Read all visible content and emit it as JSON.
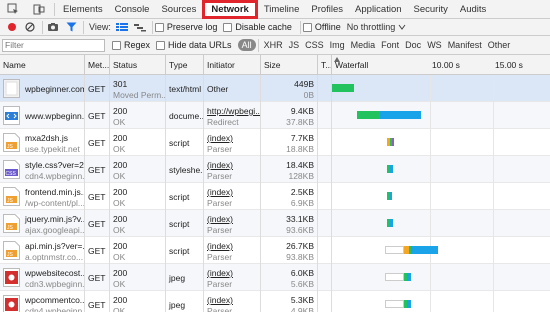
{
  "tabs": [
    {
      "label": "Elements",
      "active": false
    },
    {
      "label": "Console",
      "active": false
    },
    {
      "label": "Sources",
      "active": false
    },
    {
      "label": "Network",
      "active": true
    },
    {
      "label": "Timeline",
      "active": false
    },
    {
      "label": "Profiles",
      "active": false
    },
    {
      "label": "Application",
      "active": false
    },
    {
      "label": "Security",
      "active": false
    },
    {
      "label": "Audits",
      "active": false
    }
  ],
  "toolbar": {
    "view_label": "View:",
    "preserve_log": "Preserve log",
    "disable_cache": "Disable cache",
    "offline": "Offline",
    "throttling": "No throttling"
  },
  "filterbar": {
    "placeholder": "Filter",
    "regex": "Regex",
    "hide_data_urls": "Hide data URLs",
    "types": [
      "All",
      "XHR",
      "JS",
      "CSS",
      "Img",
      "Media",
      "Font",
      "Doc",
      "WS",
      "Manifest",
      "Other"
    ]
  },
  "columns": {
    "name": "Name",
    "method": "Met...",
    "status": "Status",
    "type": "Type",
    "initiator": "Initiator",
    "size": "Size",
    "time": "T...",
    "waterfall": "Waterfall",
    "tick1": "10.00 s",
    "tick2": "15.00 s"
  },
  "rows": [
    {
      "name": "wpbeginner.com",
      "domain": "",
      "method": "GET",
      "status": "301",
      "status_text": "Moved Perm...",
      "type": "text/html",
      "initiator": "Other",
      "initiator_sub": "",
      "size": "449B",
      "content": "0B",
      "icon": "html-doc-icon",
      "bars": [
        {
          "start": 0.5,
          "end": 1.2,
          "color": "#f5a623"
        },
        {
          "start": 1.2,
          "end": 4.0,
          "color": "#22c35e"
        }
      ]
    },
    {
      "name": "www.wpbeginn...",
      "domain": "",
      "method": "GET",
      "status": "200",
      "status_text": "OK",
      "type": "docume...",
      "initiator": "http://wpbegi...",
      "initiator_sub": "Redirect",
      "size": "9.4KB",
      "content": "37.8KB",
      "icon": "html-code-icon",
      "bars": [
        {
          "start": 4.2,
          "end": 6.0,
          "color": "#22c35e"
        },
        {
          "start": 6.0,
          "end": 9.3,
          "color": "#1aa3e8"
        }
      ]
    },
    {
      "name": "mxa2dsh.js",
      "domain": "use.typekit.net",
      "method": "GET",
      "status": "200",
      "status_text": "OK",
      "type": "script",
      "initiator": "(index)",
      "initiator_sub": "Parser",
      "size": "7.7KB",
      "content": "18.8KB",
      "icon": "js-file-icon",
      "bars": [
        {
          "start": 6.6,
          "end": 6.8,
          "color": "#f5a623"
        },
        {
          "start": 6.8,
          "end": 7.0,
          "color": "#22c35e"
        },
        {
          "start": 7.0,
          "end": 7.1,
          "color": "#9b59b6"
        }
      ]
    },
    {
      "name": "style.css?ver=2...",
      "domain": "cdn4.wpbeginn...",
      "method": "GET",
      "status": "200",
      "status_text": "OK",
      "type": "styleshe...",
      "initiator": "(index)",
      "initiator_sub": "Parser",
      "size": "18.4KB",
      "content": "128KB",
      "icon": "css-file-icon",
      "bars": [
        {
          "start": 6.6,
          "end": 6.8,
          "color": "#22c35e"
        },
        {
          "start": 6.8,
          "end": 7.1,
          "color": "#1aa3e8"
        }
      ]
    },
    {
      "name": "frontend.min.js...",
      "domain": "/wp-content/pl...",
      "method": "GET",
      "status": "200",
      "status_text": "OK",
      "type": "script",
      "initiator": "(index)",
      "initiator_sub": "Parser",
      "size": "2.5KB",
      "content": "6.9KB",
      "icon": "js-file-icon",
      "bars": [
        {
          "start": 6.6,
          "end": 6.8,
          "color": "#22c35e"
        },
        {
          "start": 6.8,
          "end": 7.0,
          "color": "#1aa3e8"
        }
      ]
    },
    {
      "name": "jquery.min.js?v...",
      "domain": "ajax.googleapi...",
      "method": "GET",
      "status": "200",
      "status_text": "OK",
      "type": "script",
      "initiator": "(index)",
      "initiator_sub": "Parser",
      "size": "33.1KB",
      "content": "93.6KB",
      "icon": "js-file-icon",
      "bars": [
        {
          "start": 6.6,
          "end": 6.8,
          "color": "#22c35e"
        },
        {
          "start": 6.8,
          "end": 7.1,
          "color": "#1aa3e8"
        }
      ]
    },
    {
      "name": "api.min.js?ver=...",
      "domain": "a.optnmstr.co...",
      "method": "GET",
      "status": "200",
      "status_text": "OK",
      "type": "script",
      "initiator": "(index)",
      "initiator_sub": "Parser",
      "size": "26.7KB",
      "content": "93.8KB",
      "icon": "js-file-icon",
      "bars": [
        {
          "start": 6.4,
          "end": 7.9,
          "color": "#ffffff"
        },
        {
          "start": 7.9,
          "end": 8.3,
          "color": "#f5a623"
        },
        {
          "start": 8.3,
          "end": 8.5,
          "color": "#22c35e"
        },
        {
          "start": 8.5,
          "end": 10.6,
          "color": "#1aa3e8"
        }
      ]
    },
    {
      "name": "wpwebsitecost...",
      "domain": "cdn3.wpbeginn...",
      "method": "GET",
      "status": "200",
      "status_text": "OK",
      "type": "jpeg",
      "initiator": "(index)",
      "initiator_sub": "Parser",
      "size": "6.0KB",
      "content": "5.6KB",
      "icon": "image-file-icon",
      "bars": [
        {
          "start": 6.4,
          "end": 7.9,
          "color": "#ffffff"
        },
        {
          "start": 7.9,
          "end": 8.2,
          "color": "#22c35e"
        },
        {
          "start": 8.2,
          "end": 8.5,
          "color": "#1aa3e8"
        }
      ]
    },
    {
      "name": "wpcommentco...",
      "domain": "cdn4.wpbeginn...",
      "method": "GET",
      "status": "200",
      "status_text": "OK",
      "type": "jpeg",
      "initiator": "(index)",
      "initiator_sub": "Parser",
      "size": "5.3KB",
      "content": "4.9KB",
      "icon": "image-file-icon",
      "bars": [
        {
          "start": 6.4,
          "end": 7.9,
          "color": "#ffffff"
        },
        {
          "start": 7.9,
          "end": 8.2,
          "color": "#22c35e"
        },
        {
          "start": 8.2,
          "end": 8.5,
          "color": "#1aa3e8"
        }
      ]
    }
  ],
  "colors": {
    "record_red": "#e0262c",
    "active_blue": "#1a73e8",
    "highlight_red": "#e0262c"
  }
}
